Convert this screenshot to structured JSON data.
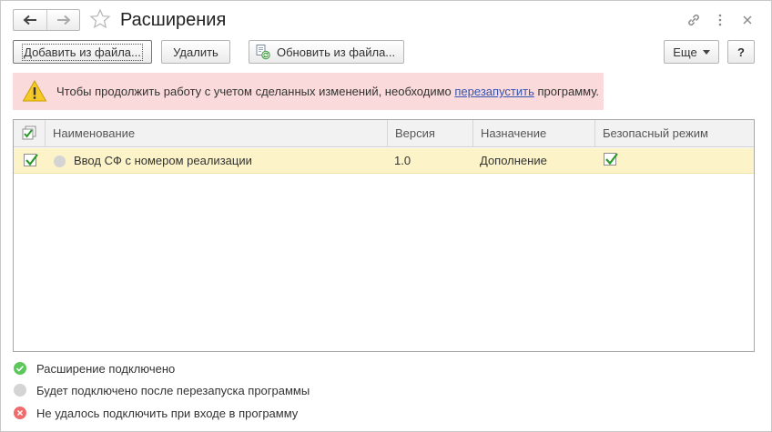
{
  "window": {
    "title": "Расширения"
  },
  "toolbar": {
    "add_from_file": "Добавить из файла...",
    "delete": "Удалить",
    "update_from_file": "Обновить из файла...",
    "more": "Еще",
    "help": "?"
  },
  "warning": {
    "text_before": "Чтобы продолжить работу с учетом сделанных изменений, необходимо ",
    "link": "перезапустить",
    "text_after": " программу."
  },
  "table": {
    "columns": {
      "name": "Наименование",
      "version": "Версия",
      "purpose": "Назначение",
      "safe_mode": "Безопасный режим"
    },
    "rows": [
      {
        "active": true,
        "status": "pending",
        "name": "Ввод СФ с номером реализации",
        "version": "1.0",
        "purpose": "Дополнение",
        "safe_mode": true
      }
    ]
  },
  "legend": [
    {
      "status": "connected",
      "text": "Расширение подключено",
      "color": "#5cc85c"
    },
    {
      "status": "pending",
      "text": "Будет подключено после перезапуска программы",
      "color": "#d4d4d4"
    },
    {
      "status": "failed",
      "text": "Не удалось подключить при входе в программу",
      "color": "#f06c6c"
    }
  ],
  "colors": {
    "warning_bg": "#fadada",
    "selected_row": "#fcf3c8",
    "check_green": "#2e9a2e",
    "link": "#3455b0"
  }
}
